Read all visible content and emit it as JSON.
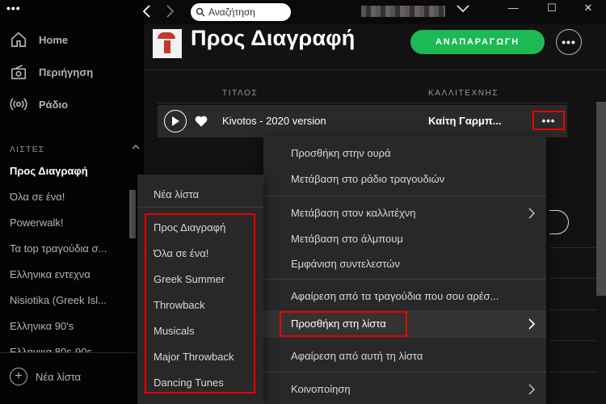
{
  "sidebar": {
    "nav": [
      {
        "label": "Home",
        "icon": "home-icon"
      },
      {
        "label": "Περιήγηση",
        "icon": "browse-icon"
      },
      {
        "label": "Ράδιο",
        "icon": "radio-icon"
      }
    ],
    "section_label": "ΛΙΣΤΕΣ",
    "playlists": [
      "Προς Διαγραφή",
      "Όλα σε ένα!",
      "Powerwalk!",
      "Τα top τραγούδια σ...",
      "Ελληνικα εντεχνα",
      "Nisiotika (Greek Isl...",
      "Ελληνικα 90's",
      "Ελληνικα 80s-90s..."
    ],
    "new_list": "Νέα λίστα"
  },
  "topbar": {
    "search_placeholder": "Αναζήτηση",
    "window_buttons": [
      "—",
      "☐",
      "✕"
    ]
  },
  "header": {
    "title": "Προς Διαγραφή",
    "play_label": "ΑΝΑΠΑΡΑΓΩΓΗ",
    "more_label": "•••"
  },
  "tracklist": {
    "columns": [
      "ΤΙΤΛΟΣ",
      "ΚΑΛΛΙΤΕΧΝΗΣ"
    ],
    "row": {
      "title": "Kivotos - 2020 version",
      "artist": "Καίτη Γαρμπ...",
      "more": "•••"
    }
  },
  "context_menu": {
    "items": [
      "Προσθήκη στην ουρά",
      "Μετάβαση στο ράδιο τραγουδιών",
      "Μετάβαση στον καλλιτέχνη",
      "Μετάβαση στο άλμπουμ",
      "Εμφάνιση συντελεστών",
      "Αφαίρεση από τα τραγούδια που σου αρέσ...",
      "Προσθήκη στη λίστα",
      "Αφαίρεση από αυτή τη λίστα",
      "Κοινοποίηση"
    ]
  },
  "submenu": {
    "new_list": "Νέα λίστα",
    "items": [
      "Προς Διαγραφή",
      "Όλα σε ένα!",
      "Greek Summer",
      "Throwback",
      "Musicals",
      "Major Throwback",
      "Dancing Tunes"
    ]
  },
  "colors": {
    "accent": "#1db954",
    "highlight_box": "#e00000"
  }
}
